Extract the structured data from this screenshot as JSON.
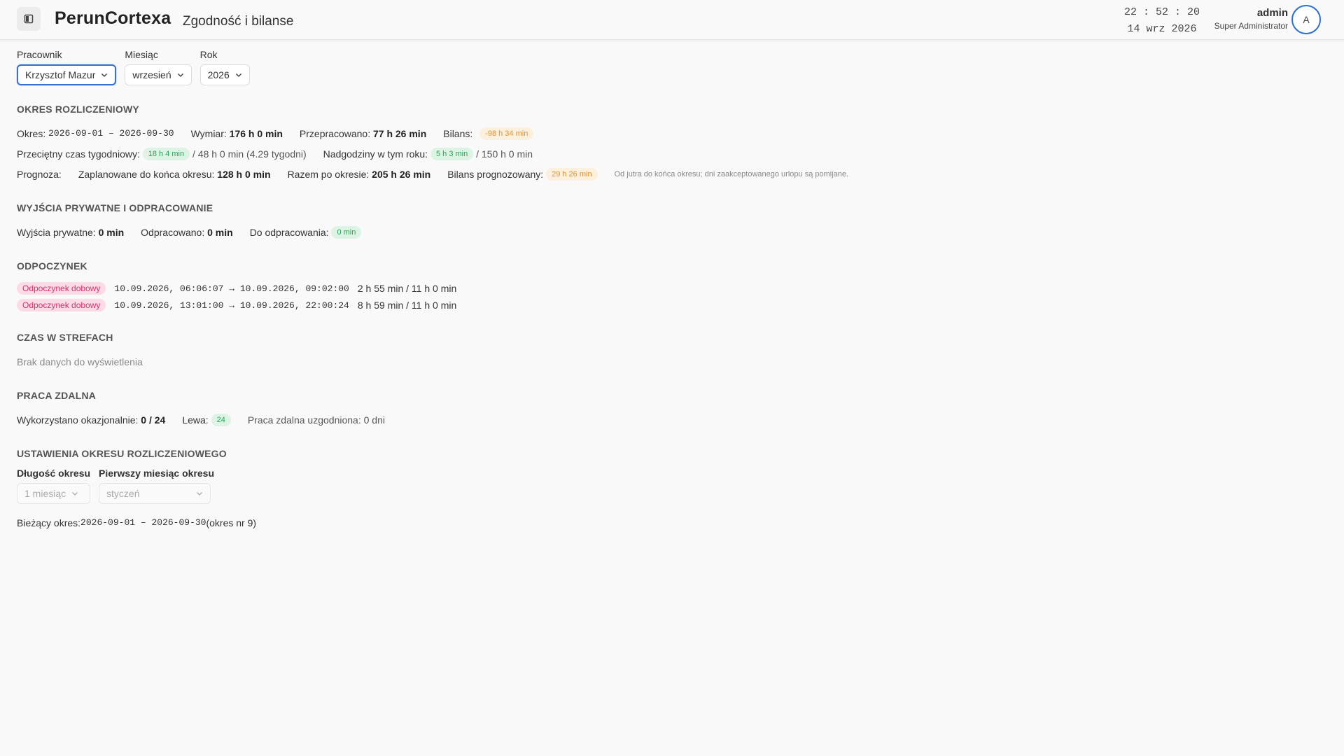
{
  "header": {
    "brand": "PerunCortexa",
    "page_title": "Zgodność i bilanse",
    "time": "22 : 52 : 20",
    "date": "14 wrz 2026",
    "user_name": "admin",
    "user_role": "Super Administrator",
    "avatar_letter": "A"
  },
  "filters": {
    "employee_label": "Pracownik",
    "employee_value": "Krzysztof Mazur",
    "month_label": "Miesiąc",
    "month_value": "wrzesień",
    "year_label": "Rok",
    "year_value": "2026"
  },
  "period": {
    "title": "OKRES ROZLICZENIOWY",
    "okres_label": "Okres: ",
    "okres_value": "2026-09-01 – 2026-09-30",
    "wymiar_label": "Wymiar: ",
    "wymiar_value": "176 h 0 min",
    "przepracowano_label": "Przepracowano: ",
    "przepracowano_value": "77 h 26 min",
    "bilans_label": "Bilans: ",
    "bilans_value": "-98 h 34 min",
    "avg_label": "Przeciętny czas tygodniowy: ",
    "avg_value": "18 h 4 min",
    "avg_suffix": " / 48 h 0 min (4.29 tygodni)",
    "overtime_label": "Nadgodziny w tym roku: ",
    "overtime_value": "5 h 3 min",
    "overtime_suffix": " / 150 h 0 min",
    "forecast_label": "Prognoza:",
    "planned_label": "Zaplanowane do końca okresu: ",
    "planned_value": "128 h 0 min",
    "total_label": "Razem po okresie: ",
    "total_value": "205 h 26 min",
    "forecast_balance_label": "Bilans prognozowany: ",
    "forecast_balance_value": "29 h 26 min",
    "forecast_note": "Od jutra do końca okresu; dni zaakceptowanego urlopu są pomijane."
  },
  "private": {
    "title": "WYJŚCIA PRYWATNE I ODPRACOWANIE",
    "exits_label": "Wyjścia prywatne: ",
    "exits_value": "0 min",
    "worked_label": "Odpracowano: ",
    "worked_value": "0 min",
    "todo_label": "Do odpracowania: ",
    "todo_value": "0 min"
  },
  "rest": {
    "title": "ODPOCZYNEK",
    "items": [
      {
        "badge": "Odpoczynek dobowy",
        "range": "10.09.2026, 06:06:07 → 10.09.2026, 09:02:00",
        "duration": "2 h 55 min / 11 h 0 min"
      },
      {
        "badge": "Odpoczynek dobowy",
        "range": "10.09.2026, 13:01:00 → 10.09.2026, 22:00:24",
        "duration": "8 h 59 min / 11 h 0 min"
      }
    ]
  },
  "zones": {
    "title": "CZAS W STREFACH",
    "empty": "Brak danych do wyświetlenia"
  },
  "remote": {
    "title": "PRACA ZDALNA",
    "used_label": "Wykorzystano okazjonalnie: ",
    "used_value": "0 / 24",
    "left_label": "Lewa: ",
    "left_value": "24",
    "agreed_text": "Praca zdalna uzgodniona: 0 dni"
  },
  "settings": {
    "title": "USTAWIENIA OKRESU ROZLICZENIOWEGO",
    "length_label": "Długość okresu",
    "length_value": "1 miesiąc",
    "first_month_label": "Pierwszy miesiąc okresu",
    "first_month_value": "styczeń",
    "current_label": "Bieżący okres: ",
    "current_value": "2026-09-01 – 2026-09-30",
    "current_suffix": " (okres nr 9)"
  },
  "colors": {
    "accent": "#2a6fd6",
    "negative_badge": "#e0912f",
    "positive_badge": "#2aa35a",
    "rest_badge": "#d6336c"
  }
}
